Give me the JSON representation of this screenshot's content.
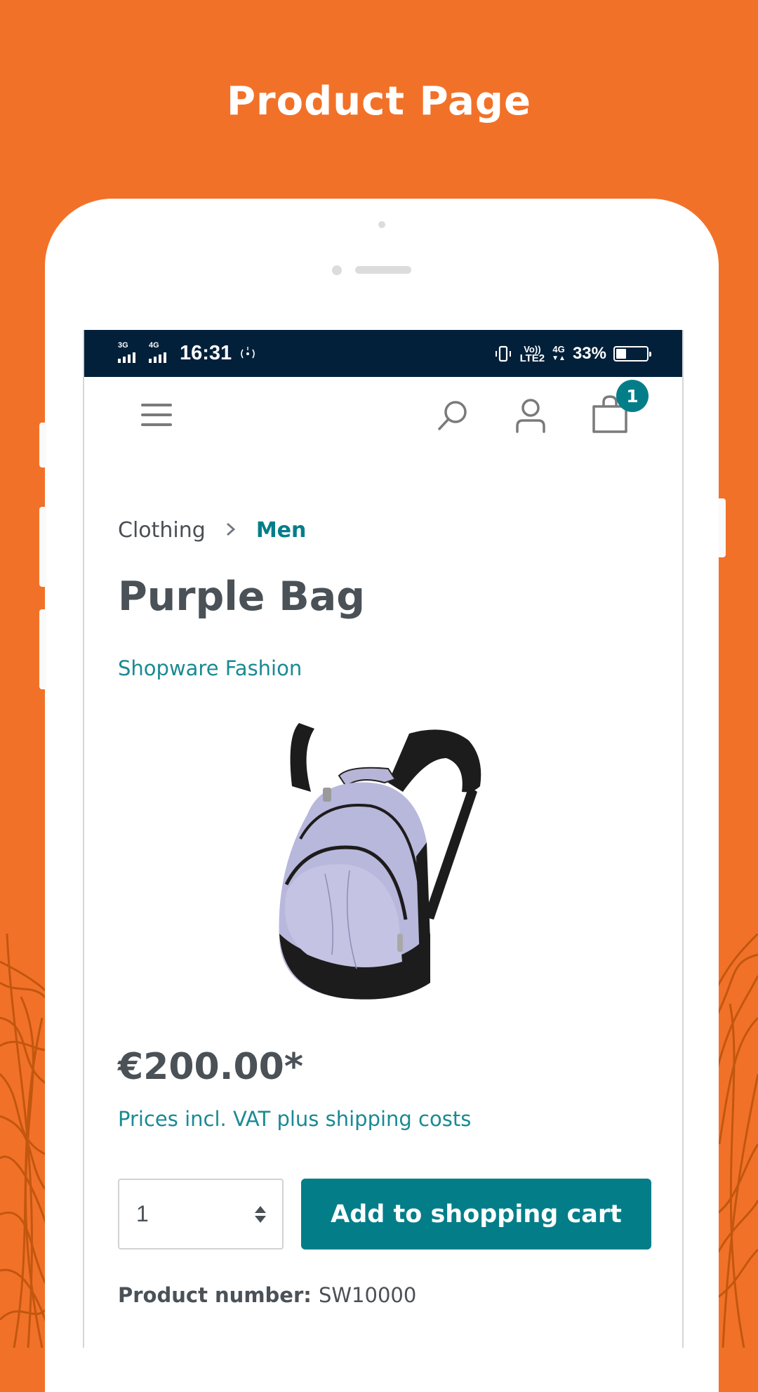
{
  "promo": {
    "title": "Product Page"
  },
  "status_bar": {
    "sim1_network": "3G",
    "sim2_network": "4G",
    "time": "16:31",
    "volte_top": "Vo))",
    "volte_bottom": "LTE2",
    "data_network": "4G",
    "battery_percent_label": "33%",
    "battery_level": 0.33
  },
  "header": {
    "menu_icon": "hamburger-menu-icon",
    "search_icon": "search-icon",
    "account_icon": "user-icon",
    "cart_icon": "shopping-bag-icon",
    "cart_count": "1"
  },
  "breadcrumb": {
    "items": [
      {
        "label": "Clothing"
      },
      {
        "label": "Men"
      }
    ],
    "separator": ">"
  },
  "product": {
    "title": "Purple Bag",
    "manufacturer": "Shopware Fashion",
    "image_alt": "Purple backpack",
    "price": "€200.00*",
    "tax_note": "Prices incl. VAT plus shipping costs",
    "quantity": "1",
    "add_to_cart_label": "Add to shopping cart",
    "product_number_label": "Product number:",
    "product_number": "SW10000"
  },
  "colors": {
    "background": "#f27128",
    "status_bar": "#02203a",
    "accent": "#037e89",
    "text": "#4a5157"
  }
}
